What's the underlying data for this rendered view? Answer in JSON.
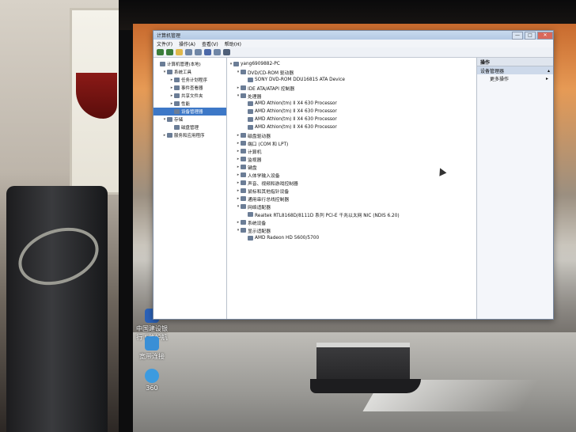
{
  "window": {
    "title": "计算机管理",
    "buttons": {
      "minimize": "—",
      "maximize": "□",
      "close": "✕"
    }
  },
  "menu": [
    "文件(F)",
    "操作(A)",
    "查看(V)",
    "帮助(H)"
  ],
  "left_tree": [
    {
      "label": "计算机管理(本地)",
      "indent": 0,
      "exp": ""
    },
    {
      "label": "系统工具",
      "indent": 1,
      "exp": "▾"
    },
    {
      "label": "任务计划程序",
      "indent": 2,
      "exp": "▸"
    },
    {
      "label": "事件查看器",
      "indent": 2,
      "exp": "▸"
    },
    {
      "label": "共享文件夹",
      "indent": 2,
      "exp": "▸"
    },
    {
      "label": "性能",
      "indent": 2,
      "exp": "▸"
    },
    {
      "label": "设备管理器",
      "indent": 2,
      "exp": "",
      "selected": true
    },
    {
      "label": "存储",
      "indent": 1,
      "exp": "▾"
    },
    {
      "label": "磁盘管理",
      "indent": 2,
      "exp": ""
    },
    {
      "label": "服务和应用程序",
      "indent": 1,
      "exp": "▸"
    }
  ],
  "device_tree": [
    {
      "label": "yang6909882-PC",
      "indent": 0,
      "exp": "▾"
    },
    {
      "label": "DVD/CD-ROM 驱动器",
      "indent": 1,
      "exp": "▾"
    },
    {
      "label": "SONY DVD-ROM DDU1681S ATA Device",
      "indent": 2,
      "exp": ""
    },
    {
      "label": "IDE ATA/ATAPI 控制器",
      "indent": 1,
      "exp": "▸"
    },
    {
      "label": "处理器",
      "indent": 1,
      "exp": "▾"
    },
    {
      "label": "AMD Athlon(tm) II X4 630 Processor",
      "indent": 2,
      "exp": ""
    },
    {
      "label": "AMD Athlon(tm) II X4 630 Processor",
      "indent": 2,
      "exp": ""
    },
    {
      "label": "AMD Athlon(tm) II X4 630 Processor",
      "indent": 2,
      "exp": ""
    },
    {
      "label": "AMD Athlon(tm) II X4 630 Processor",
      "indent": 2,
      "exp": ""
    },
    {
      "label": "磁盘驱动器",
      "indent": 1,
      "exp": "▸"
    },
    {
      "label": "端口 (COM 和 LPT)",
      "indent": 1,
      "exp": "▸"
    },
    {
      "label": "计算机",
      "indent": 1,
      "exp": "▸"
    },
    {
      "label": "监视器",
      "indent": 1,
      "exp": "▸"
    },
    {
      "label": "键盘",
      "indent": 1,
      "exp": "▸"
    },
    {
      "label": "人体学输入设备",
      "indent": 1,
      "exp": "▸"
    },
    {
      "label": "声音、视频和游戏控制器",
      "indent": 1,
      "exp": "▸"
    },
    {
      "label": "鼠标和其他指针设备",
      "indent": 1,
      "exp": "▸"
    },
    {
      "label": "通用串行总线控制器",
      "indent": 1,
      "exp": "▸"
    },
    {
      "label": "网络适配器",
      "indent": 1,
      "exp": "▾"
    },
    {
      "label": "Realtek RTL8168D/8111D 系列 PCI-E 千兆以太网 NIC (NDIS 6.20)",
      "indent": 2,
      "exp": ""
    },
    {
      "label": "系统设备",
      "indent": 1,
      "exp": "▸"
    },
    {
      "label": "显示适配器",
      "indent": 1,
      "exp": "▾"
    },
    {
      "label": "AMD Radeon HD 5600/5700",
      "indent": 2,
      "exp": ""
    }
  ],
  "actions": {
    "header": "操作",
    "section": "设备管理器",
    "more": "更多操作"
  },
  "desktop_icons": [
    {
      "label": "中国建设银行 E路护航",
      "color": "#2b62b8"
    },
    {
      "label": "宽带连接",
      "color": "#3a8fd6"
    },
    {
      "label": "360",
      "color": "#3c9be0"
    }
  ]
}
